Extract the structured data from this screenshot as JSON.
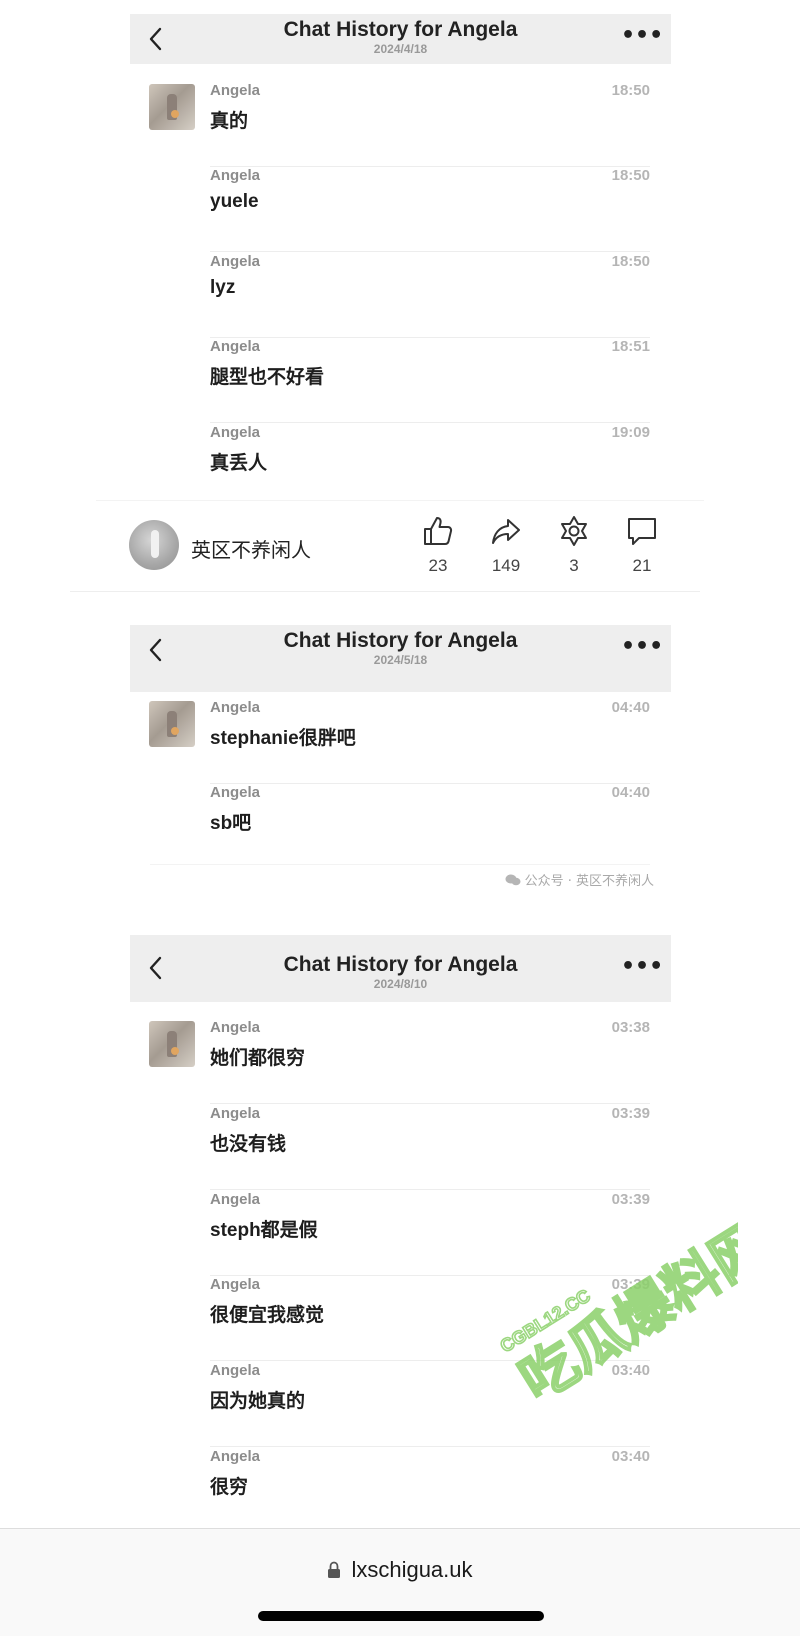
{
  "panels": [
    {
      "header": {
        "title": "Chat History for Angela",
        "date": "2024/4/18"
      },
      "messages": [
        {
          "sender": "Angela",
          "time": "18:50",
          "text": "真的"
        },
        {
          "sender": "Angela",
          "time": "18:50",
          "text": "yuele"
        },
        {
          "sender": "Angela",
          "time": "18:50",
          "text": "lyz"
        },
        {
          "sender": "Angela",
          "time": "18:51",
          "text": "腿型也不好看"
        },
        {
          "sender": "Angela",
          "time": "19:09",
          "text": "真丢人"
        }
      ]
    },
    {
      "header": {
        "title": "Chat History for Angela",
        "date": "2024/5/18"
      },
      "messages": [
        {
          "sender": "Angela",
          "time": "04:40",
          "text": "stephanie很胖吧"
        },
        {
          "sender": "Angela",
          "time": "04:40",
          "text": "sb吧"
        }
      ]
    },
    {
      "header": {
        "title": "Chat History for Angela",
        "date": "2024/8/10"
      },
      "messages": [
        {
          "sender": "Angela",
          "time": "03:38",
          "text": "她们都很穷"
        },
        {
          "sender": "Angela",
          "time": "03:39",
          "text": "也没有钱"
        },
        {
          "sender": "Angela",
          "time": "03:39",
          "text": "steph都是假"
        },
        {
          "sender": "Angela",
          "time": "03:39",
          "text": "很便宜我感觉"
        },
        {
          "sender": "Angela",
          "time": "03:40",
          "text": "因为她真的"
        },
        {
          "sender": "Angela",
          "time": "03:40",
          "text": "很穷"
        }
      ]
    }
  ],
  "social": {
    "account_name": "英区不养闲人",
    "likes": "23",
    "shares": "149",
    "favorites": "3",
    "comments": "21"
  },
  "wechat_watermark": "公众号 · 英区不养闲人",
  "stamp_watermark": {
    "top": "CGBL12.CC",
    "main": "吃瓜爆料网"
  },
  "browser": {
    "url": "lxschigua.uk"
  },
  "colors": {
    "header_bg": "#eeeeee",
    "text_primary": "#1e1e1e",
    "sender_gray": "#8c8c8c",
    "time_gray": "#b5b5b5",
    "stamp_green": "#8bd16a",
    "stamp_red": "#e05a55"
  },
  "icons": {
    "back": "chevron-left-icon",
    "more": "more-dots-icon",
    "like": "thumbs-up-icon",
    "share": "share-arrow-icon",
    "favorite": "star-icon",
    "comment": "comment-icon",
    "lock": "lock-icon",
    "wechat": "wechat-icon"
  }
}
